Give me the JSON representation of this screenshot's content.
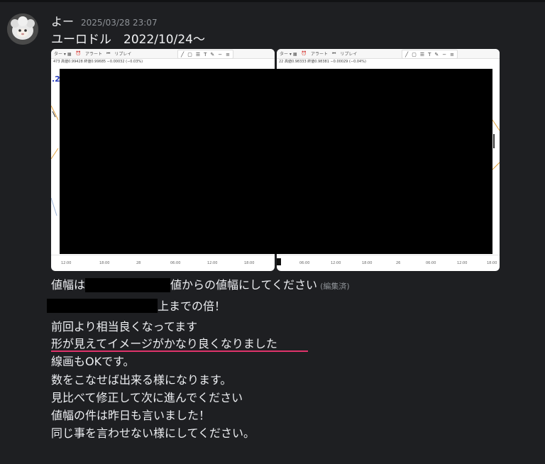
{
  "message": {
    "username": "よー",
    "timestamp": "2025/03/28 23:07",
    "title": "ユーロドル　2022/10/24～",
    "edited_label": "(編集済)",
    "line1_start": "値幅は",
    "line1_end": "値からの値幅にしてください",
    "line2_end": "上までの倍！",
    "line3": "前回より相当良くなってます",
    "line4": "形が見えてイメージがかなり良くなりました",
    "line5": "線画もOKです。",
    "line6": "数をこなせば出来る様になります。",
    "line7": "見比べて修正して次に進んでください",
    "line8": "値幅の件は昨日も言いました！",
    "line9": "同じ事を言わせない様にしてください。"
  },
  "shot1": {
    "toolbar_alert": "アラート",
    "toolbar_replay": "リプレイ",
    "info": "473 高値0.99428 終値0.99685 −0.00032 (−0.03%)",
    "price_label": ".2",
    "axis": [
      "12:00",
      "18:00",
      "28",
      "06:00",
      "12:00",
      "18:00"
    ]
  },
  "shot2": {
    "toolbar_alert": "アラート",
    "toolbar_replay": "リプレイ",
    "info": "22 高値0.98333 終値0.98381 −0.00029 (−0.04%)",
    "axis": [
      "06:00",
      "12:00",
      "18:00",
      "26",
      "06:00",
      "12:00",
      "18:00"
    ]
  },
  "colors": {
    "background": "#1e1f22",
    "underline": "#e0336b"
  }
}
